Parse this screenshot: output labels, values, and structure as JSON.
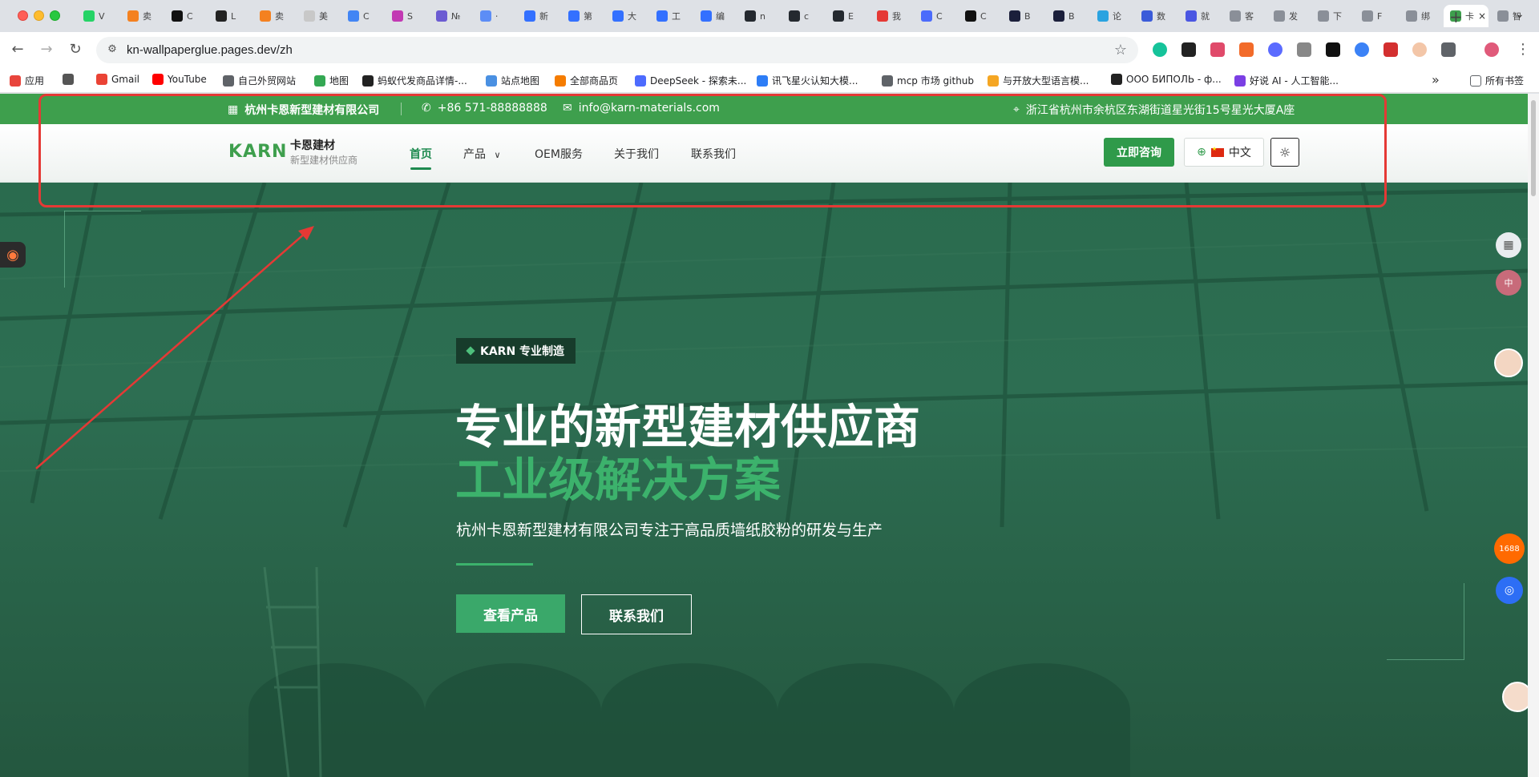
{
  "browser": {
    "url": "kn-wallpaperglue.pages.dev/zh",
    "tabs": [
      {
        "label": "V",
        "color": "#25d366"
      },
      {
        "label": "卖",
        "color": "#f48120"
      },
      {
        "label": "C",
        "color": "#111111"
      },
      {
        "label": "L",
        "color": "#222222"
      },
      {
        "label": "卖",
        "color": "#f48120"
      },
      {
        "label": "美",
        "color": "#c8c8c8"
      },
      {
        "label": "C",
        "color": "#4285f4"
      },
      {
        "label": "S",
        "color": "#c239b3"
      },
      {
        "label": "№",
        "color": "#6b5bd2"
      },
      {
        "label": "⋅",
        "color": "#5c8df6"
      },
      {
        "label": "新",
        "color": "#3370ff"
      },
      {
        "label": "第",
        "color": "#3370ff"
      },
      {
        "label": "大",
        "color": "#3370ff"
      },
      {
        "label": "工",
        "color": "#3370ff"
      },
      {
        "label": "编",
        "color": "#3370ff"
      },
      {
        "label": "n",
        "color": "#24292f"
      },
      {
        "label": "c",
        "color": "#24292f"
      },
      {
        "label": "E",
        "color": "#24292f"
      },
      {
        "label": "我",
        "color": "#e53935"
      },
      {
        "label": "C",
        "color": "#4b6bfb"
      },
      {
        "label": "C",
        "color": "#111111"
      },
      {
        "label": "B",
        "color": "#1b1f3b"
      },
      {
        "label": "B",
        "color": "#1b1f3b"
      },
      {
        "label": "论",
        "color": "#2aa3e0"
      },
      {
        "label": "数",
        "color": "#3a5bd9"
      },
      {
        "label": "就",
        "color": "#4a56e2"
      },
      {
        "label": "客",
        "color": "#8a8f98"
      },
      {
        "label": "发",
        "color": "#8a8f98"
      },
      {
        "label": "下",
        "color": "#8a8f98"
      },
      {
        "label": "F",
        "color": "#8a8f98"
      },
      {
        "label": "绑",
        "color": "#8a8f98"
      },
      {
        "label": "卡",
        "color": "#3e9f4d"
      },
      {
        "label": "智",
        "color": "#8a8f98"
      }
    ],
    "active_tab_index": 31,
    "bookmarks": [
      {
        "label": "应用",
        "color": "#e8453c"
      },
      {
        "label": "",
        "color": "#555555"
      },
      {
        "label": "Gmail",
        "color": "#ea4335"
      },
      {
        "label": "YouTube",
        "color": "#ff0000"
      },
      {
        "label": "自己外贸网站",
        "color": "#5f6368"
      },
      {
        "label": "地图",
        "color": "#34a853"
      },
      {
        "label": "蚂蚁代发商品详情-...",
        "color": "#222222"
      },
      {
        "label": "站点地图",
        "color": "#4a90e2"
      },
      {
        "label": "全部商品页",
        "color": "#f57c00"
      },
      {
        "label": "DeepSeek - 探索未...",
        "color": "#4d6bfe"
      },
      {
        "label": "讯飞星火认知大模...",
        "color": "#2d7df6"
      },
      {
        "label": "mcp 市场 github",
        "color": "#5f6368"
      },
      {
        "label": "与开放大型语言模...",
        "color": "#f5a623"
      },
      {
        "label": "ООО БИПОЛЬ - ф...",
        "color": "#222222"
      },
      {
        "label": "好说 AI - 人工智能...",
        "color": "#7b3fe4"
      }
    ],
    "all_bookmarks_label": "所有书签"
  },
  "topbar": {
    "company": "杭州卡恩新型建材有限公司",
    "phone": "+86 571-88888888",
    "email": "info@karn-materials.com",
    "address": "浙江省杭州市余杭区东湖街道星光街15号星光大厦A座"
  },
  "header": {
    "logo": "KARN",
    "brand_name": "卡恩建材",
    "brand_sub": "新型建材供应商",
    "nav": {
      "home": "首页",
      "products": "产品",
      "oem": "OEM服务",
      "about": "关于我们",
      "contact": "联系我们"
    },
    "cta": "立即咨询",
    "language": "中文"
  },
  "hero": {
    "badge": "KARN 专业制造",
    "title_line1": "专业的新型建材供应商",
    "title_line2": "工业级解决方案",
    "description": "杭州卡恩新型建材有限公司专注于高品质墙纸胶粉的研发与生产",
    "btn_products": "查看产品",
    "btn_contact": "联系我们"
  },
  "colors": {
    "brand_green": "#3e9f4d",
    "accent_green": "#3cb26c",
    "annotation_red": "#e53935"
  }
}
